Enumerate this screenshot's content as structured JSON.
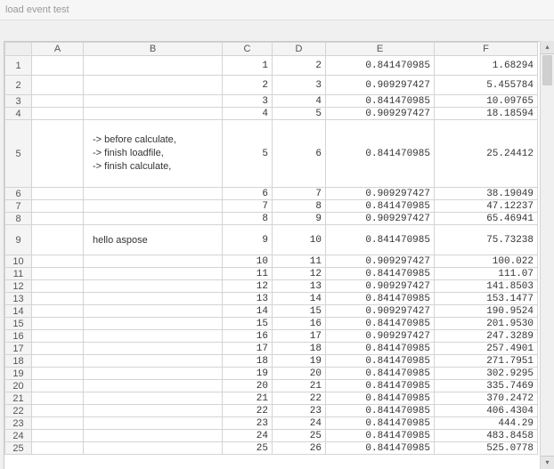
{
  "window_title": "load event test",
  "columns": [
    "A",
    "B",
    "C",
    "D",
    "E",
    "F"
  ],
  "rows": [
    {
      "n": 1,
      "hcls": "h22",
      "A": "",
      "B": "",
      "C": "1",
      "D": "2",
      "E": "0.841470985",
      "F": "1.68294"
    },
    {
      "n": 2,
      "hcls": "h22",
      "A": "",
      "B": "",
      "C": "2",
      "D": "3",
      "E": "0.909297427",
      "F": "5.455784"
    },
    {
      "n": 3,
      "hcls": "h14",
      "A": "",
      "B": "",
      "C": "3",
      "D": "4",
      "E": "0.841470985",
      "F": "10.09765"
    },
    {
      "n": 4,
      "hcls": "h14",
      "A": "",
      "B": "",
      "C": "4",
      "D": "5",
      "E": "0.909297427",
      "F": "18.18594"
    },
    {
      "n": 5,
      "hcls": "h76",
      "A": "",
      "B": "-> before calculate,\n-> finish loadfile,\n-> finish calculate,",
      "C": "5",
      "D": "6",
      "E": "0.841470985",
      "F": "25.24412"
    },
    {
      "n": 6,
      "hcls": "h14",
      "A": "",
      "B": "",
      "C": "6",
      "D": "7",
      "E": "0.909297427",
      "F": "38.19049"
    },
    {
      "n": 7,
      "hcls": "h14",
      "A": "",
      "B": "",
      "C": "7",
      "D": "8",
      "E": "0.841470985",
      "F": "47.12237"
    },
    {
      "n": 8,
      "hcls": "h14",
      "A": "",
      "B": "",
      "C": "8",
      "D": "9",
      "E": "0.909297427",
      "F": "65.46941"
    },
    {
      "n": 9,
      "hcls": "h34",
      "A": "",
      "B": "hello aspose",
      "C": "9",
      "D": "10",
      "E": "0.841470985",
      "F": "75.73238"
    },
    {
      "n": 10,
      "hcls": "h14",
      "A": "",
      "B": "",
      "C": "10",
      "D": "11",
      "E": "0.909297427",
      "F": "100.022"
    },
    {
      "n": 11,
      "hcls": "h14",
      "A": "",
      "B": "",
      "C": "11",
      "D": "12",
      "E": "0.841470985",
      "F": "111.07"
    },
    {
      "n": 12,
      "hcls": "h14",
      "A": "",
      "B": "",
      "C": "12",
      "D": "13",
      "E": "0.909297427",
      "F": "141.8503"
    },
    {
      "n": 13,
      "hcls": "h14",
      "A": "",
      "B": "",
      "C": "13",
      "D": "14",
      "E": "0.841470985",
      "F": "153.1477"
    },
    {
      "n": 14,
      "hcls": "h14",
      "A": "",
      "B": "",
      "C": "14",
      "D": "15",
      "E": "0.909297427",
      "F": "190.9524"
    },
    {
      "n": 15,
      "hcls": "h14",
      "A": "",
      "B": "",
      "C": "15",
      "D": "16",
      "E": "0.841470985",
      "F": "201.9530"
    },
    {
      "n": 16,
      "hcls": "h14",
      "A": "",
      "B": "",
      "C": "16",
      "D": "17",
      "E": "0.909297427",
      "F": "247.3289"
    },
    {
      "n": 17,
      "hcls": "h14",
      "A": "",
      "B": "",
      "C": "17",
      "D": "18",
      "E": "0.841470985",
      "F": "257.4901"
    },
    {
      "n": 18,
      "hcls": "h14",
      "A": "",
      "B": "",
      "C": "18",
      "D": "19",
      "E": "0.841470985",
      "F": "271.7951"
    },
    {
      "n": 19,
      "hcls": "h14",
      "A": "",
      "B": "",
      "C": "19",
      "D": "20",
      "E": "0.841470985",
      "F": "302.9295"
    },
    {
      "n": 20,
      "hcls": "h14",
      "A": "",
      "B": "",
      "C": "20",
      "D": "21",
      "E": "0.841470985",
      "F": "335.7469"
    },
    {
      "n": 21,
      "hcls": "h14",
      "A": "",
      "B": "",
      "C": "21",
      "D": "22",
      "E": "0.841470985",
      "F": "370.2472"
    },
    {
      "n": 22,
      "hcls": "h14",
      "A": "",
      "B": "",
      "C": "22",
      "D": "23",
      "E": "0.841470985",
      "F": "406.4304"
    },
    {
      "n": 23,
      "hcls": "h14",
      "A": "",
      "B": "",
      "C": "23",
      "D": "24",
      "E": "0.841470985",
      "F": "444.29"
    },
    {
      "n": 24,
      "hcls": "h14",
      "A": "",
      "B": "",
      "C": "24",
      "D": "25",
      "E": "0.841470985",
      "F": "483.8458"
    },
    {
      "n": 25,
      "hcls": "h14",
      "A": "",
      "B": "",
      "C": "25",
      "D": "26",
      "E": "0.841470985",
      "F": "525.0778"
    }
  ]
}
